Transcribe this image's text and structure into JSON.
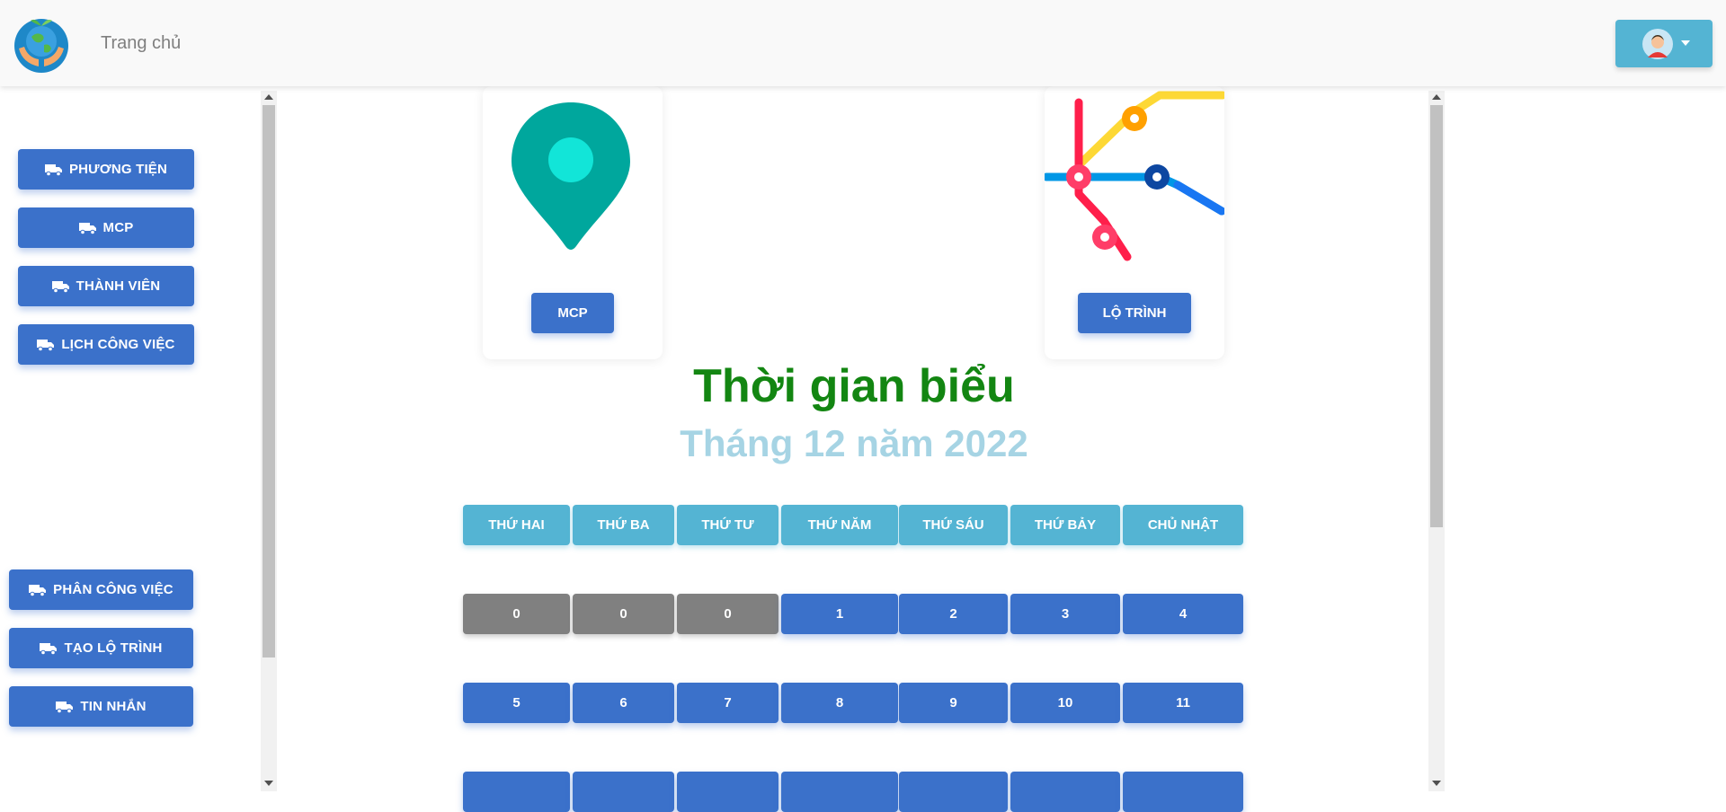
{
  "header": {
    "home_label": "Trang chủ"
  },
  "sidebar": {
    "top_items": [
      {
        "label": "PHƯƠNG TIỆN"
      },
      {
        "label": "MCP"
      },
      {
        "label": "THÀNH VIÊN"
      },
      {
        "label": "LỊCH CÔNG VIỆC"
      }
    ],
    "bottom_items": [
      {
        "label": "PHÂN CÔNG VIỆC"
      },
      {
        "label": "TẠO LỘ TRÌNH"
      },
      {
        "label": "TIN NHẮN"
      }
    ]
  },
  "cards": {
    "mcp_label": "MCP",
    "route_label": "LỘ TRÌNH"
  },
  "schedule": {
    "title": "Thời gian biểu",
    "subtitle": "Tháng 12 năm 2022",
    "weekdays": [
      "THỨ HAI",
      "THỨ BA",
      "THỨ TƯ",
      "THỨ NĂM",
      "THỨ SÁU",
      "THỨ BẢY",
      "CHỦ NHẬT"
    ],
    "rows": [
      [
        "0",
        "0",
        "0",
        "1",
        "2",
        "3",
        "4"
      ],
      [
        "5",
        "6",
        "7",
        "8",
        "9",
        "10",
        "11"
      ]
    ]
  },
  "colors": {
    "primary": "#3b71ca",
    "info": "#54b4d3",
    "past_day": "#808080",
    "title_green": "#138612",
    "subtitle_blue": "#a6d4e4"
  }
}
